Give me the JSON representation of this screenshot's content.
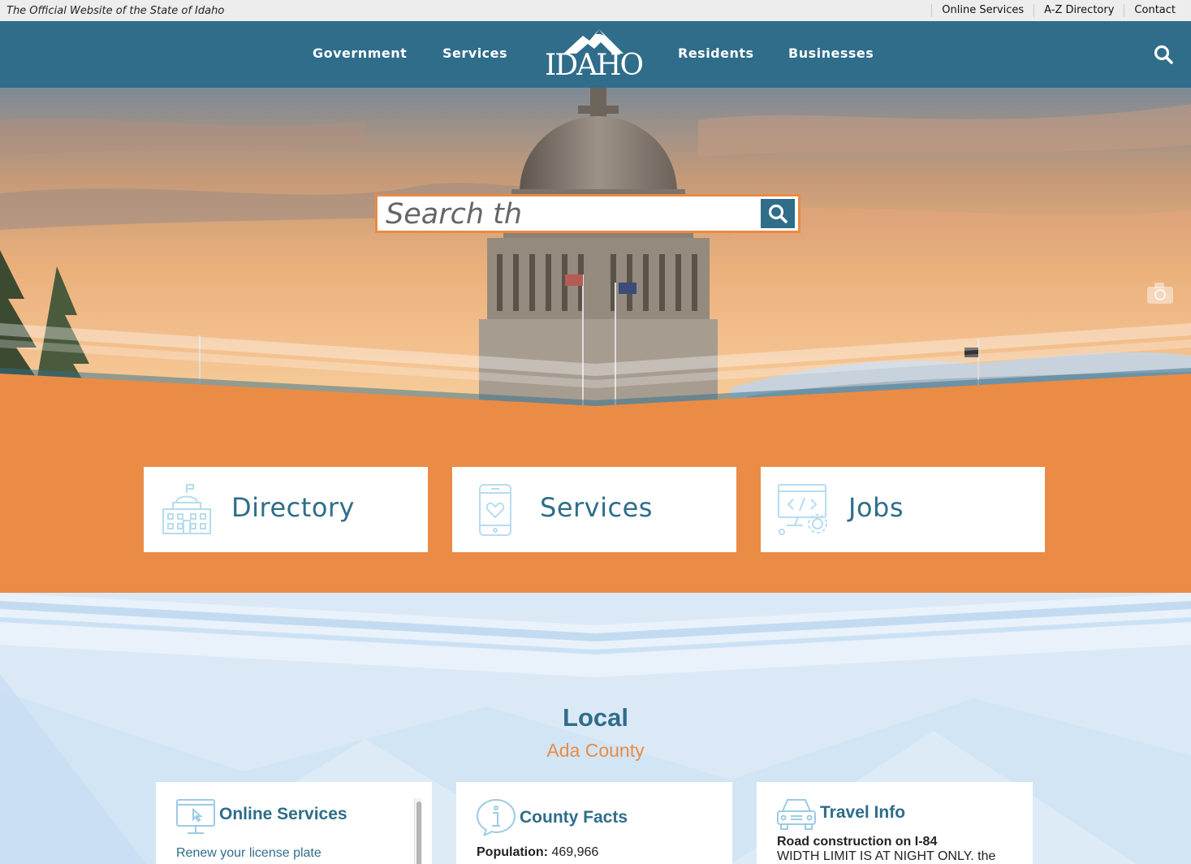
{
  "utility_bar": {
    "tagline": "The Official Website of the State of Idaho",
    "links": [
      "Online Services",
      "A-Z Directory",
      "Contact"
    ]
  },
  "nav": {
    "items": [
      "Government",
      "Services",
      "Residents",
      "Businesses"
    ],
    "logo_text": "IDAHO",
    "search_icon": "search-icon"
  },
  "hero": {
    "search_placeholder": "Search th",
    "search_button_icon": "search-icon",
    "camera_icon": "camera-icon"
  },
  "quick_links": [
    {
      "label": "Directory",
      "icon": "capitol-building-icon"
    },
    {
      "label": "Services",
      "icon": "smartphone-heart-icon"
    },
    {
      "label": "Jobs",
      "icon": "computer-code-gear-icon"
    }
  ],
  "local": {
    "title": "Local",
    "county": "Ada County",
    "cards": {
      "online_services": {
        "title": "Online Services",
        "link": "Renew your license plate",
        "icon": "computer-pointer-icon"
      },
      "county_facts": {
        "title": "County Facts",
        "population_label": "Population:",
        "population_value": "469,966",
        "icon": "info-bubble-icon"
      },
      "travel_info": {
        "title": "Travel Info",
        "headline": "Road construction on I-84",
        "detail": "WIDTH LIMIT IS AT NIGHT ONLY. the",
        "icon": "car-icon"
      }
    }
  },
  "colors": {
    "brand_blue": "#2f6d8a",
    "accent_orange": "#e98b45",
    "light_blue_bg": "#dbe9f7"
  }
}
